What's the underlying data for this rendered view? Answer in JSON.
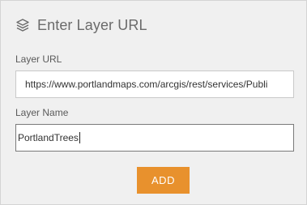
{
  "header": {
    "icon": "layers-icon",
    "title": "Enter Layer URL"
  },
  "layer_url": {
    "label": "Layer URL",
    "value": "https://www.portlandmaps.com/arcgis/rest/services/Publi"
  },
  "layer_name": {
    "label": "Layer Name",
    "value": "PortlandTrees"
  },
  "add_button": {
    "label": "ADD",
    "color": "#e8912d"
  },
  "colors": {
    "panel_bg": "#f0f0f0",
    "text": "#6b6b6b"
  }
}
